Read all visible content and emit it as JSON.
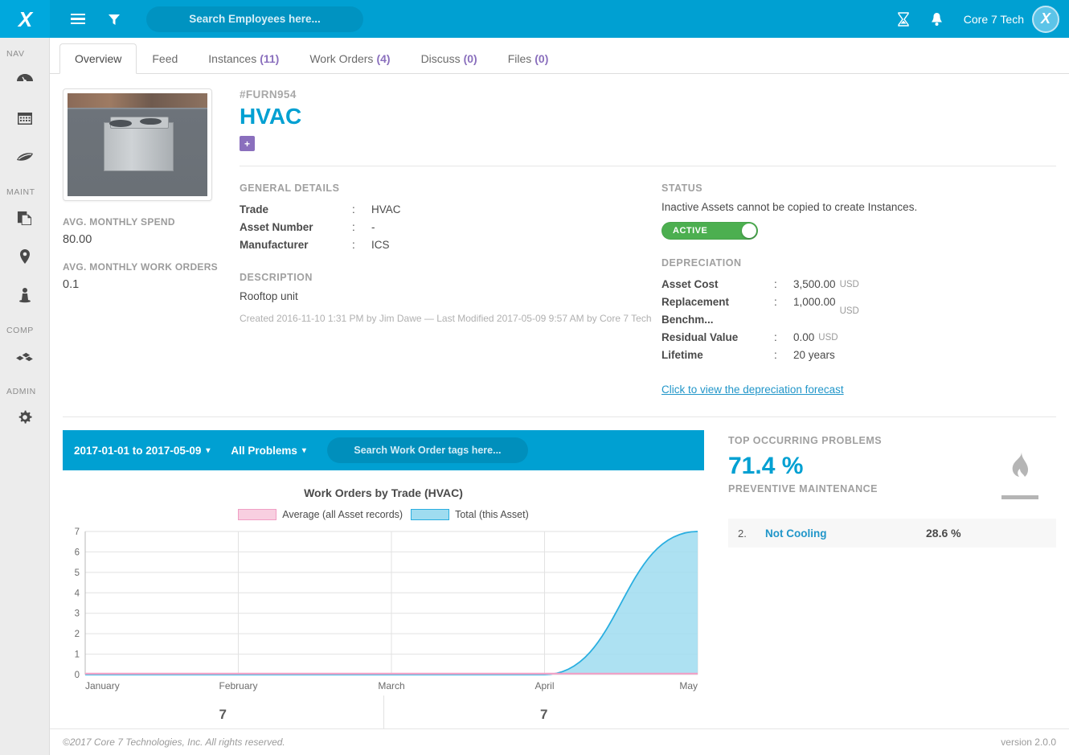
{
  "topbar": {
    "logo_text": "X",
    "menu_icon": "hamburger-icon",
    "filter_icon": "funnel-icon",
    "search_placeholder": "Search Employees here...",
    "pending_icon": "hourglass-icon",
    "notifications_icon": "bell-icon",
    "user_name": "Core 7 Tech",
    "avatar_initial": "X"
  },
  "sidebar": {
    "groups": [
      {
        "label": "NAV",
        "items": [
          {
            "label": "Dashboard",
            "icon": "dashboard-gauge-icon"
          },
          {
            "label": "Calendar",
            "icon": "calendar-icon"
          },
          {
            "label": "Problems",
            "icon": "flame-leaf-icon"
          }
        ]
      },
      {
        "label": "MAINT",
        "items": [
          {
            "label": "Assets",
            "icon": "copy-documents-icon"
          },
          {
            "label": "Locations",
            "icon": "map-pin-icon"
          },
          {
            "label": "Employees",
            "icon": "person-icon"
          }
        ]
      },
      {
        "label": "COMP",
        "items": [
          {
            "label": "Inventory",
            "icon": "boxes-icon"
          }
        ]
      },
      {
        "label": "ADMIN",
        "items": [
          {
            "label": "Settings",
            "icon": "gear-icon"
          }
        ]
      }
    ]
  },
  "tabs": [
    {
      "label": "Overview",
      "count": "",
      "active": true
    },
    {
      "label": "Feed",
      "count": "",
      "active": false
    },
    {
      "label": "Instances",
      "count": "(11)",
      "active": false
    },
    {
      "label": "Work Orders",
      "count": "(4)",
      "active": false
    },
    {
      "label": "Discuss",
      "count": "(0)",
      "active": false
    },
    {
      "label": "Files",
      "count": "(0)",
      "active": false
    }
  ],
  "asset": {
    "id": "#FURN954",
    "title": "HVAC",
    "add_badge": "+",
    "photo_alt": "Rooftop HVAC unit photo",
    "avg_monthly_spend_label": "AVG. MONTHLY SPEND",
    "avg_monthly_spend_value": "80.00",
    "avg_monthly_wo_label": "AVG. MONTHLY WORK ORDERS",
    "avg_monthly_wo_value": "0.1",
    "general_details_heading": "GENERAL DETAILS",
    "general_details": [
      {
        "key": "Trade",
        "colon": ":",
        "value": "HVAC"
      },
      {
        "key": "Asset Number",
        "colon": ":",
        "value": "-"
      },
      {
        "key": "Manufacturer",
        "colon": ":",
        "value": "ICS"
      }
    ],
    "description_heading": "DESCRIPTION",
    "description": "Rooftop unit",
    "meta": "Created 2016-11-10 1:31 PM by Jim Dawe — Last Modified 2017-05-09 9:57 AM by Core 7 Tech"
  },
  "status": {
    "heading": "STATUS",
    "note": "Inactive Assets cannot be copied to create Instances.",
    "toggle_label": "ACTIVE",
    "toggle_on": true,
    "toggle_color": "#4caf50"
  },
  "depreciation": {
    "heading": "DEPRECIATION",
    "rows": [
      {
        "key": "Asset Cost",
        "colon": ":",
        "value": "3,500.00",
        "unit": "USD"
      },
      {
        "key": "Replacement Benchm...",
        "colon": ":",
        "value": "1,000.00",
        "unit": "USD"
      },
      {
        "key": "Residual Value",
        "colon": ":",
        "value": "0.00",
        "unit": "USD"
      },
      {
        "key": "Lifetime",
        "colon": ":",
        "value": "20 years",
        "unit": ""
      }
    ],
    "forecast_link": "Click to view the depreciation forecast"
  },
  "filterbar": {
    "date_range": "2017-01-01 to 2017-05-09",
    "problem_filter": "All Problems",
    "tag_search_placeholder": "Search Work Order tags here..."
  },
  "chart_data": {
    "type": "area",
    "title": "Work Orders by Trade (HVAC)",
    "xlabel": "",
    "ylabel": "",
    "ylim": [
      0,
      7
    ],
    "yticks": [
      0,
      1,
      2,
      3,
      4,
      5,
      6,
      7
    ],
    "categories": [
      "January",
      "February",
      "March",
      "April",
      "May"
    ],
    "grid": true,
    "legend_position": "top",
    "series": [
      {
        "name": "Average (all Asset records)",
        "color": "#f09ec4",
        "fill": "#f8cfe0",
        "values": [
          0.05,
          0.05,
          0.05,
          0.05,
          0.05
        ]
      },
      {
        "name": "Total (this Asset)",
        "color": "#29aee0",
        "fill": "#9fdcf0",
        "values": [
          0,
          0,
          0,
          0,
          7
        ]
      }
    ]
  },
  "chart_totals": [
    "7",
    "7"
  ],
  "problems": {
    "heading": "TOP OCCURRING PROBLEMS",
    "top_pct": "71.4 %",
    "top_name": "PREVENTIVE MAINTENANCE",
    "icon": "flame-icon",
    "rows": [
      {
        "rank": "2.",
        "name": "Not Cooling",
        "pct": "28.6 %"
      }
    ]
  },
  "footer": {
    "copyright": "©2017 Core 7 Technologies, Inc. All rights reserved.",
    "version": "version 2.0.0"
  }
}
